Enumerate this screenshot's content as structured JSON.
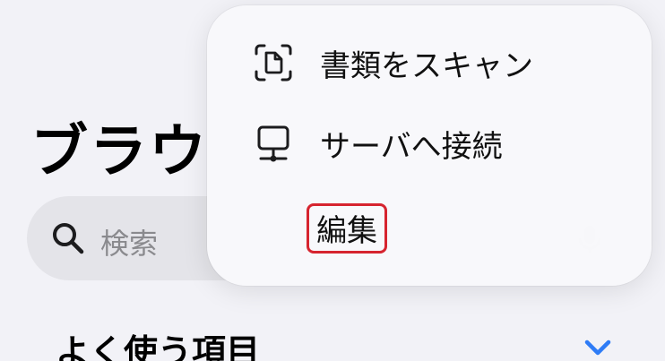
{
  "background": {
    "title": "ブラウ",
    "search": {
      "placeholder": "検索",
      "icon": "magnifying-glass"
    },
    "section_title": "よく使う項目"
  },
  "menu": {
    "items": [
      {
        "label": "書類をスキャン",
        "icon": "document-scan"
      },
      {
        "label": "サーバへ接続",
        "icon": "monitor-network"
      }
    ],
    "edit_label": "編集"
  },
  "colors": {
    "background": "#f2f2f7",
    "menu": "#f8f8fb",
    "highlight_border": "#d6242f",
    "accent": "#2f7cf6"
  }
}
